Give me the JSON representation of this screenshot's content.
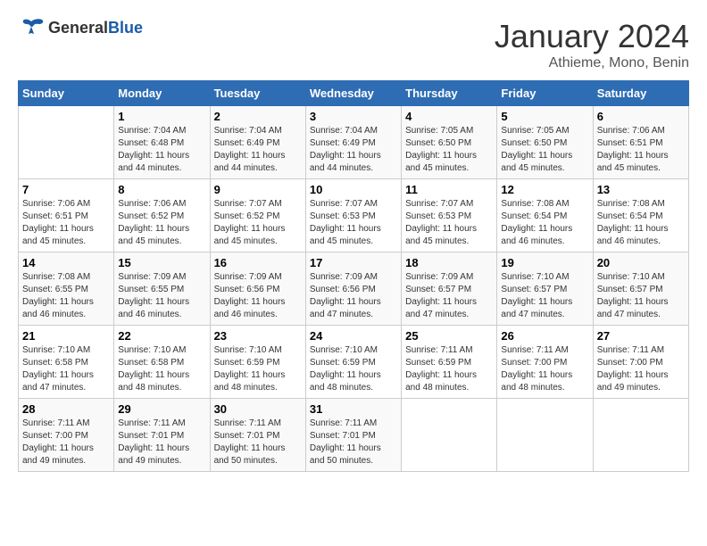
{
  "header": {
    "logo": {
      "general": "General",
      "blue": "Blue"
    },
    "title": "January 2024",
    "subtitle": "Athieme, Mono, Benin"
  },
  "calendar": {
    "days_of_week": [
      "Sunday",
      "Monday",
      "Tuesday",
      "Wednesday",
      "Thursday",
      "Friday",
      "Saturday"
    ],
    "weeks": [
      [
        {
          "day": "",
          "info": ""
        },
        {
          "day": "1",
          "info": "Sunrise: 7:04 AM\nSunset: 6:48 PM\nDaylight: 11 hours\nand 44 minutes."
        },
        {
          "day": "2",
          "info": "Sunrise: 7:04 AM\nSunset: 6:49 PM\nDaylight: 11 hours\nand 44 minutes."
        },
        {
          "day": "3",
          "info": "Sunrise: 7:04 AM\nSunset: 6:49 PM\nDaylight: 11 hours\nand 44 minutes."
        },
        {
          "day": "4",
          "info": "Sunrise: 7:05 AM\nSunset: 6:50 PM\nDaylight: 11 hours\nand 45 minutes."
        },
        {
          "day": "5",
          "info": "Sunrise: 7:05 AM\nSunset: 6:50 PM\nDaylight: 11 hours\nand 45 minutes."
        },
        {
          "day": "6",
          "info": "Sunrise: 7:06 AM\nSunset: 6:51 PM\nDaylight: 11 hours\nand 45 minutes."
        }
      ],
      [
        {
          "day": "7",
          "info": "Sunrise: 7:06 AM\nSunset: 6:51 PM\nDaylight: 11 hours\nand 45 minutes."
        },
        {
          "day": "8",
          "info": "Sunrise: 7:06 AM\nSunset: 6:52 PM\nDaylight: 11 hours\nand 45 minutes."
        },
        {
          "day": "9",
          "info": "Sunrise: 7:07 AM\nSunset: 6:52 PM\nDaylight: 11 hours\nand 45 minutes."
        },
        {
          "day": "10",
          "info": "Sunrise: 7:07 AM\nSunset: 6:53 PM\nDaylight: 11 hours\nand 45 minutes."
        },
        {
          "day": "11",
          "info": "Sunrise: 7:07 AM\nSunset: 6:53 PM\nDaylight: 11 hours\nand 45 minutes."
        },
        {
          "day": "12",
          "info": "Sunrise: 7:08 AM\nSunset: 6:54 PM\nDaylight: 11 hours\nand 46 minutes."
        },
        {
          "day": "13",
          "info": "Sunrise: 7:08 AM\nSunset: 6:54 PM\nDaylight: 11 hours\nand 46 minutes."
        }
      ],
      [
        {
          "day": "14",
          "info": "Sunrise: 7:08 AM\nSunset: 6:55 PM\nDaylight: 11 hours\nand 46 minutes."
        },
        {
          "day": "15",
          "info": "Sunrise: 7:09 AM\nSunset: 6:55 PM\nDaylight: 11 hours\nand 46 minutes."
        },
        {
          "day": "16",
          "info": "Sunrise: 7:09 AM\nSunset: 6:56 PM\nDaylight: 11 hours\nand 46 minutes."
        },
        {
          "day": "17",
          "info": "Sunrise: 7:09 AM\nSunset: 6:56 PM\nDaylight: 11 hours\nand 47 minutes."
        },
        {
          "day": "18",
          "info": "Sunrise: 7:09 AM\nSunset: 6:57 PM\nDaylight: 11 hours\nand 47 minutes."
        },
        {
          "day": "19",
          "info": "Sunrise: 7:10 AM\nSunset: 6:57 PM\nDaylight: 11 hours\nand 47 minutes."
        },
        {
          "day": "20",
          "info": "Sunrise: 7:10 AM\nSunset: 6:57 PM\nDaylight: 11 hours\nand 47 minutes."
        }
      ],
      [
        {
          "day": "21",
          "info": "Sunrise: 7:10 AM\nSunset: 6:58 PM\nDaylight: 11 hours\nand 47 minutes."
        },
        {
          "day": "22",
          "info": "Sunrise: 7:10 AM\nSunset: 6:58 PM\nDaylight: 11 hours\nand 48 minutes."
        },
        {
          "day": "23",
          "info": "Sunrise: 7:10 AM\nSunset: 6:59 PM\nDaylight: 11 hours\nand 48 minutes."
        },
        {
          "day": "24",
          "info": "Sunrise: 7:10 AM\nSunset: 6:59 PM\nDaylight: 11 hours\nand 48 minutes."
        },
        {
          "day": "25",
          "info": "Sunrise: 7:11 AM\nSunset: 6:59 PM\nDaylight: 11 hours\nand 48 minutes."
        },
        {
          "day": "26",
          "info": "Sunrise: 7:11 AM\nSunset: 7:00 PM\nDaylight: 11 hours\nand 48 minutes."
        },
        {
          "day": "27",
          "info": "Sunrise: 7:11 AM\nSunset: 7:00 PM\nDaylight: 11 hours\nand 49 minutes."
        }
      ],
      [
        {
          "day": "28",
          "info": "Sunrise: 7:11 AM\nSunset: 7:00 PM\nDaylight: 11 hours\nand 49 minutes."
        },
        {
          "day": "29",
          "info": "Sunrise: 7:11 AM\nSunset: 7:01 PM\nDaylight: 11 hours\nand 49 minutes."
        },
        {
          "day": "30",
          "info": "Sunrise: 7:11 AM\nSunset: 7:01 PM\nDaylight: 11 hours\nand 50 minutes."
        },
        {
          "day": "31",
          "info": "Sunrise: 7:11 AM\nSunset: 7:01 PM\nDaylight: 11 hours\nand 50 minutes."
        },
        {
          "day": "",
          "info": ""
        },
        {
          "day": "",
          "info": ""
        },
        {
          "day": "",
          "info": ""
        }
      ]
    ]
  }
}
